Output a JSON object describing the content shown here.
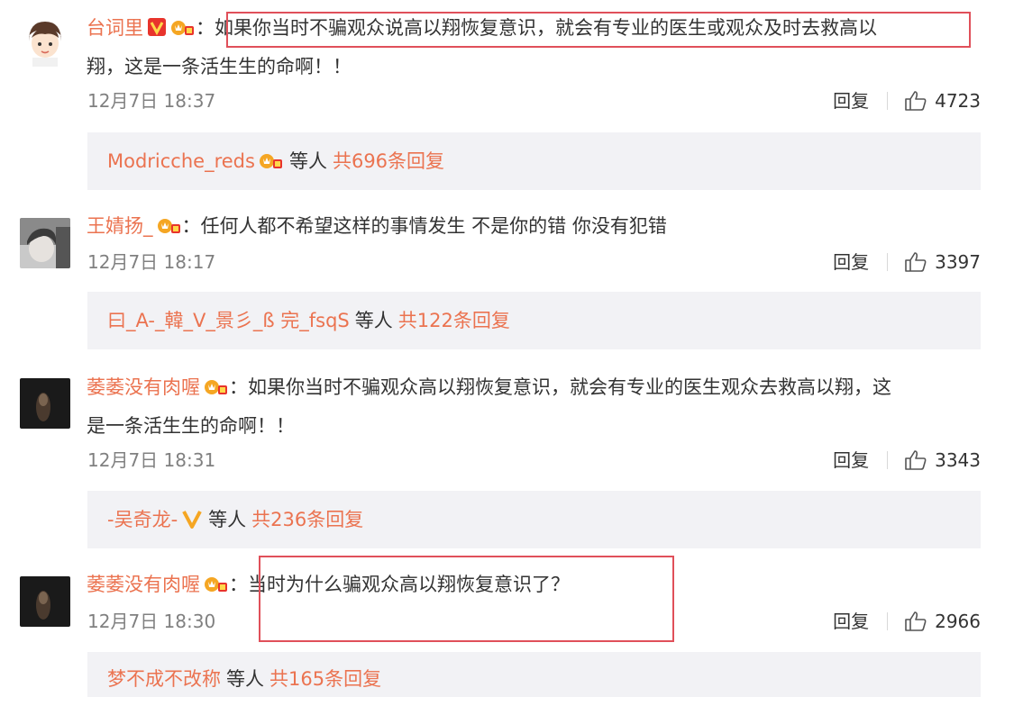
{
  "comments": [
    {
      "username": "台词里",
      "text_line1": "如果你当时不骗观众说高以翔恢复意识，就会有专业的医生或观众及时去救高以",
      "text_line2": "翔，这是一条活生生的命啊！！",
      "time": "12月7日 18:37",
      "reply_label": "回复",
      "likes": "4723",
      "reply_user": "Modricche_reds",
      "others_label": "等人",
      "total_replies": "共696条回复"
    },
    {
      "username": "王婧扬_",
      "text_line1": "任何人都不希望这样的事情发生 不是你的错 你没有犯错",
      "time": "12月7日 18:17",
      "reply_label": "回复",
      "likes": "3397",
      "reply_user": "曰_A-_韓_V_景彡_ß 完_fsqS",
      "others_label": "等人",
      "total_replies": "共122条回复"
    },
    {
      "username": "萎萎没有肉喔",
      "text_line1": "如果你当时不骗观众高以翔恢复意识，就会有专业的医生观众去救高以翔，这",
      "text_line2": "是一条活生生的命啊！！",
      "time": "12月7日 18:31",
      "reply_label": "回复",
      "likes": "3343",
      "reply_user": "-吴奇龙-",
      "others_label": "等人",
      "total_replies": "共236条回复"
    },
    {
      "username": "萎萎没有肉喔",
      "text_line1": "当时为什么骗观众高以翔恢复意识了？",
      "time": "12月7日 18:30",
      "reply_label": "回复",
      "likes": "2966",
      "reply_user": "梦不成不改称",
      "others_label": "等人",
      "total_replies": "共165条回复"
    }
  ],
  "colors": {
    "username": "#eb7350",
    "meta": "#808080",
    "reply_box_bg": "#f2f2f5",
    "highlight": "#e0505a",
    "verified_red": "#e8342c",
    "verified_gold": "#f5a623"
  },
  "icons": {
    "verified": "verified-v-icon",
    "vip": "vip-crown-icon",
    "like": "thumbs-up-icon"
  }
}
